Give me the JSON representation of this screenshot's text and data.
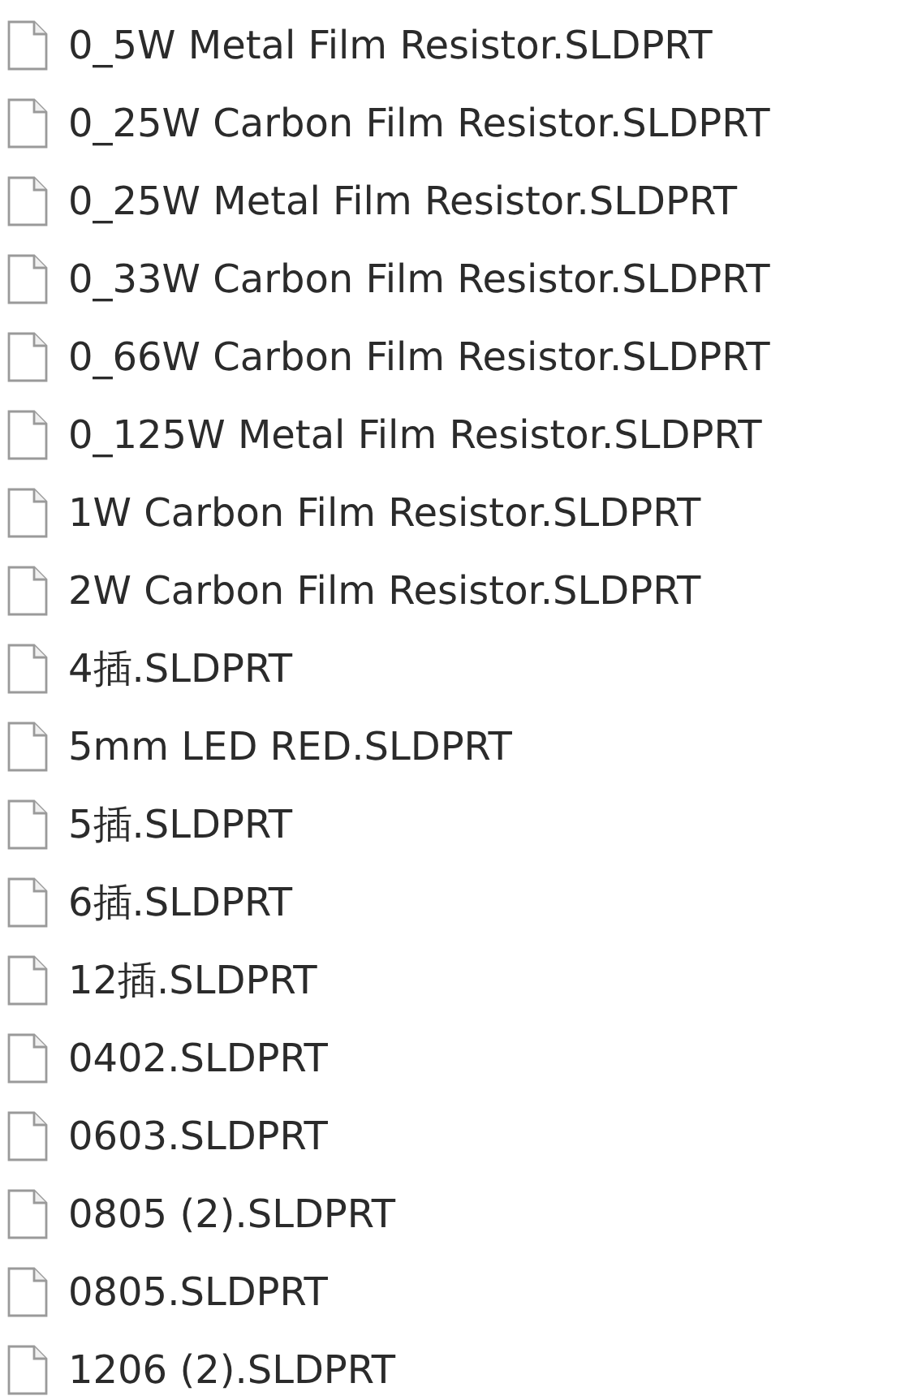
{
  "files": [
    {
      "name": "0_5W Metal Film Resistor.SLDPRT"
    },
    {
      "name": "0_25W Carbon Film Resistor.SLDPRT"
    },
    {
      "name": "0_25W Metal Film Resistor.SLDPRT"
    },
    {
      "name": "0_33W Carbon Film Resistor.SLDPRT"
    },
    {
      "name": "0_66W Carbon Film Resistor.SLDPRT"
    },
    {
      "name": "0_125W Metal Film Resistor.SLDPRT"
    },
    {
      "name": "1W Carbon Film Resistor.SLDPRT"
    },
    {
      "name": "2W Carbon Film Resistor.SLDPRT"
    },
    {
      "name": "4插.SLDPRT"
    },
    {
      "name": "5mm LED RED.SLDPRT"
    },
    {
      "name": "5插.SLDPRT"
    },
    {
      "name": "6插.SLDPRT"
    },
    {
      "name": "12插.SLDPRT"
    },
    {
      "name": "0402.SLDPRT"
    },
    {
      "name": "0603.SLDPRT"
    },
    {
      "name": "0805 (2).SLDPRT"
    },
    {
      "name": "0805.SLDPRT"
    },
    {
      "name": "1206 (2).SLDPRT"
    }
  ]
}
